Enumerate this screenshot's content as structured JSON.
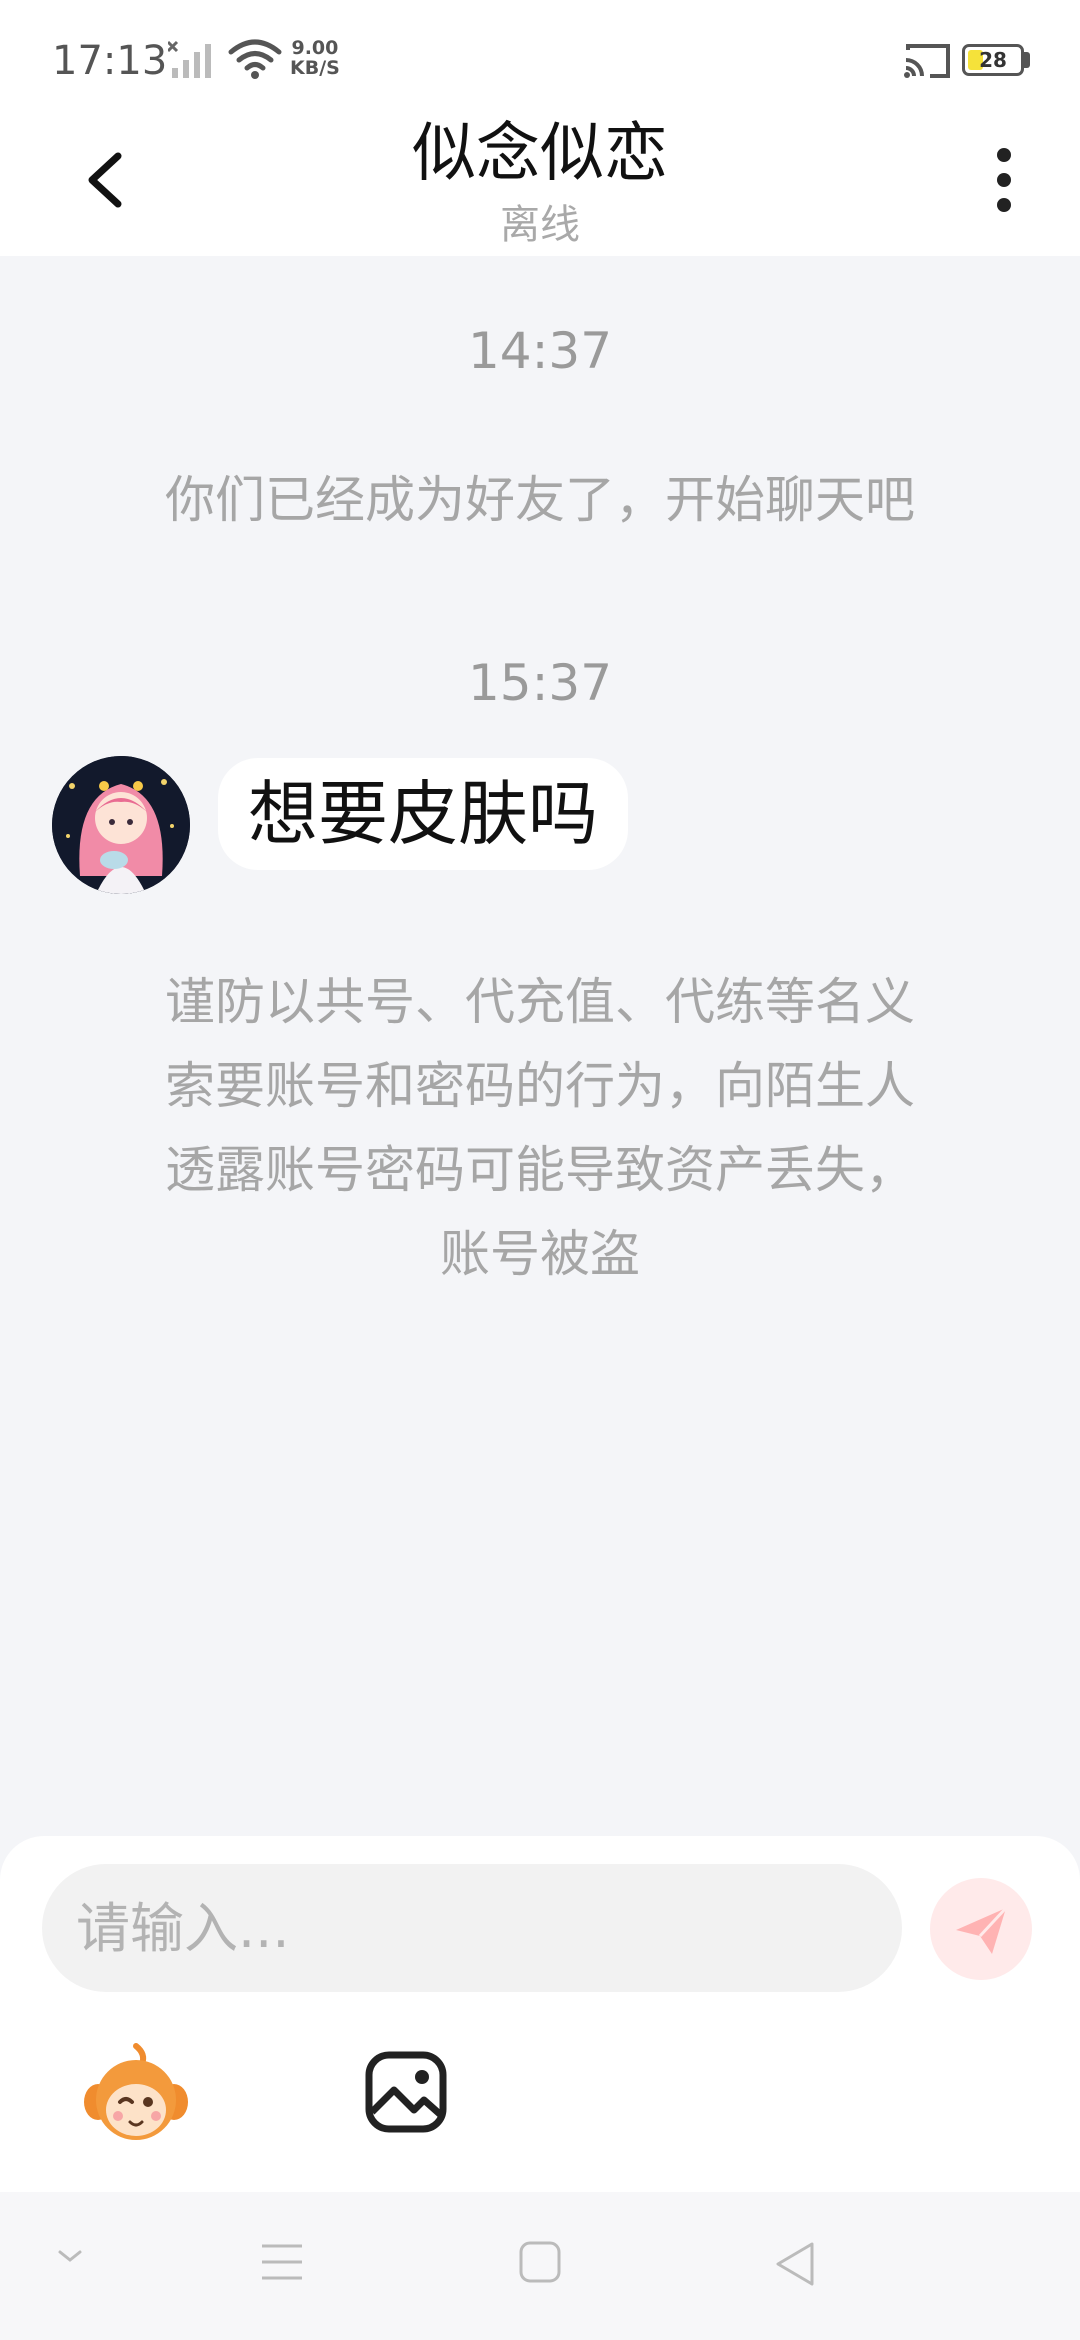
{
  "status_bar": {
    "time": "17:13",
    "net_speed_value": "9.00",
    "net_speed_unit": "KB/S",
    "battery_level": "28",
    "icons": [
      "signal-icon",
      "wifi-icon",
      "cast-icon",
      "battery-icon"
    ]
  },
  "header": {
    "title": "似念似恋",
    "status": "离线",
    "icons": [
      "back-arrow-icon",
      "more-vertical-icon"
    ]
  },
  "messages": [
    {
      "type": "time",
      "text": "14:37"
    },
    {
      "type": "system",
      "text": "你们已经成为好友了，开始聊天吧"
    },
    {
      "type": "time",
      "text": "15:37"
    },
    {
      "type": "incoming",
      "text": "想要皮肤吗",
      "avatar": "girl-avatar"
    },
    {
      "type": "system",
      "lines": [
        "谨防以共号、代充值、代练等名义",
        "索要账号和密码的行为，向陌生人",
        "透露账号密码可能导致资产丢失，",
        "账号被盗"
      ]
    }
  ],
  "input": {
    "placeholder": "请输入...",
    "value": ""
  },
  "toolbar": {
    "icons": [
      "emoji-mascot-icon",
      "image-icon",
      "send-icon"
    ]
  },
  "nav_bar": {
    "icons": [
      "collapse-icon",
      "menu-icon",
      "home-icon",
      "back-icon"
    ]
  },
  "colors": {
    "chat_background": "#f4f5f8",
    "bubble_background": "#ffffff",
    "muted_text": "#a6a6a6",
    "send_button_bg": "#ffeaea",
    "send_button_icon": "#ffb3b3"
  }
}
